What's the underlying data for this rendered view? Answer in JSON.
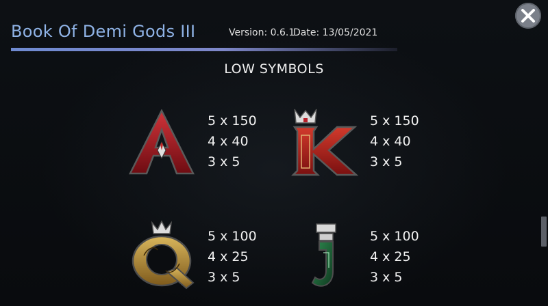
{
  "header": {
    "title": "Book Of Demi Gods III",
    "version": "Version: 0.6.1",
    "date": "Date: 13/05/2021"
  },
  "section": {
    "title": "LOW SYMBOLS"
  },
  "symbols": [
    {
      "name": "A",
      "payouts": [
        "5 x 150",
        "4 x 40",
        "3 x 5"
      ]
    },
    {
      "name": "K",
      "payouts": [
        "5 x 150",
        "4 x 40",
        "3 x 5"
      ]
    },
    {
      "name": "Q",
      "payouts": [
        "5 x 100",
        "4 x 25",
        "3 x 5"
      ]
    },
    {
      "name": "J",
      "payouts": [
        "5 x 100",
        "4 x 25",
        "3 x 5"
      ]
    }
  ],
  "colors": {
    "title": "#8fb3e6",
    "ace_red": "#a01a22",
    "king_red": "#b02020",
    "queen_gold": "#b8913a",
    "jack_green": "#1f6a3a"
  },
  "icons": {
    "close": "close-x-icon"
  }
}
